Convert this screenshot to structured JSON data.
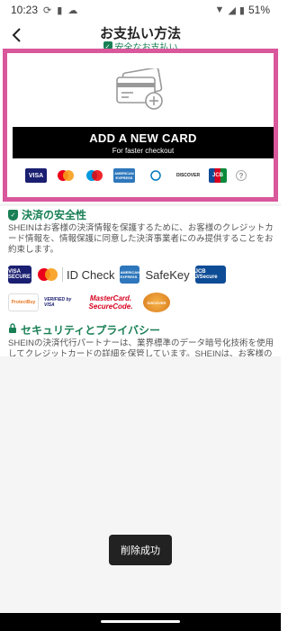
{
  "status_bar": {
    "time": "10:23",
    "battery": "51%"
  },
  "header": {
    "title": "お支払い方法",
    "secure_text": "安全なお支払い"
  },
  "add_card": {
    "button_title": "ADD A NEW CARD",
    "button_subtitle": "For faster checkout",
    "logos": [
      "VISA",
      "mastercard",
      "Maestro",
      "AMERICAN EXPRESS",
      "Diners Club",
      "DISCOVER",
      "JCB",
      "?"
    ]
  },
  "payment_security": {
    "title": "決済の安全性",
    "text": "SHEINはお客様の決済情報を保護するために、お客様のクレジットカード情報を、情報保護に同意した決済事業者にのみ提供することをお約束します。",
    "badges_row1": [
      "VISA SECURE",
      "ID Check",
      "AMERICAN EXPRESS",
      "SafeKey",
      "JCB J/Secure"
    ],
    "badges_row2": [
      "ProtectBuy",
      "VERIFIED by VISA",
      "MasterCard. SecureCode.",
      "DISCOVER"
    ]
  },
  "privacy": {
    "title": "セキュリティとプライバシー",
    "text": "SHEINの決済代行パートナーは、業界標準のデータ暗号化技術を使用してクレジットカードの詳細を保管しています。SHEINは、お客様のクレジットカード情報を保存することはありません。"
  },
  "toast": {
    "text": "削除成功"
  },
  "colors": {
    "accent_green": "#198055",
    "highlight_pink": "#d9579b",
    "button_black": "#000000"
  }
}
